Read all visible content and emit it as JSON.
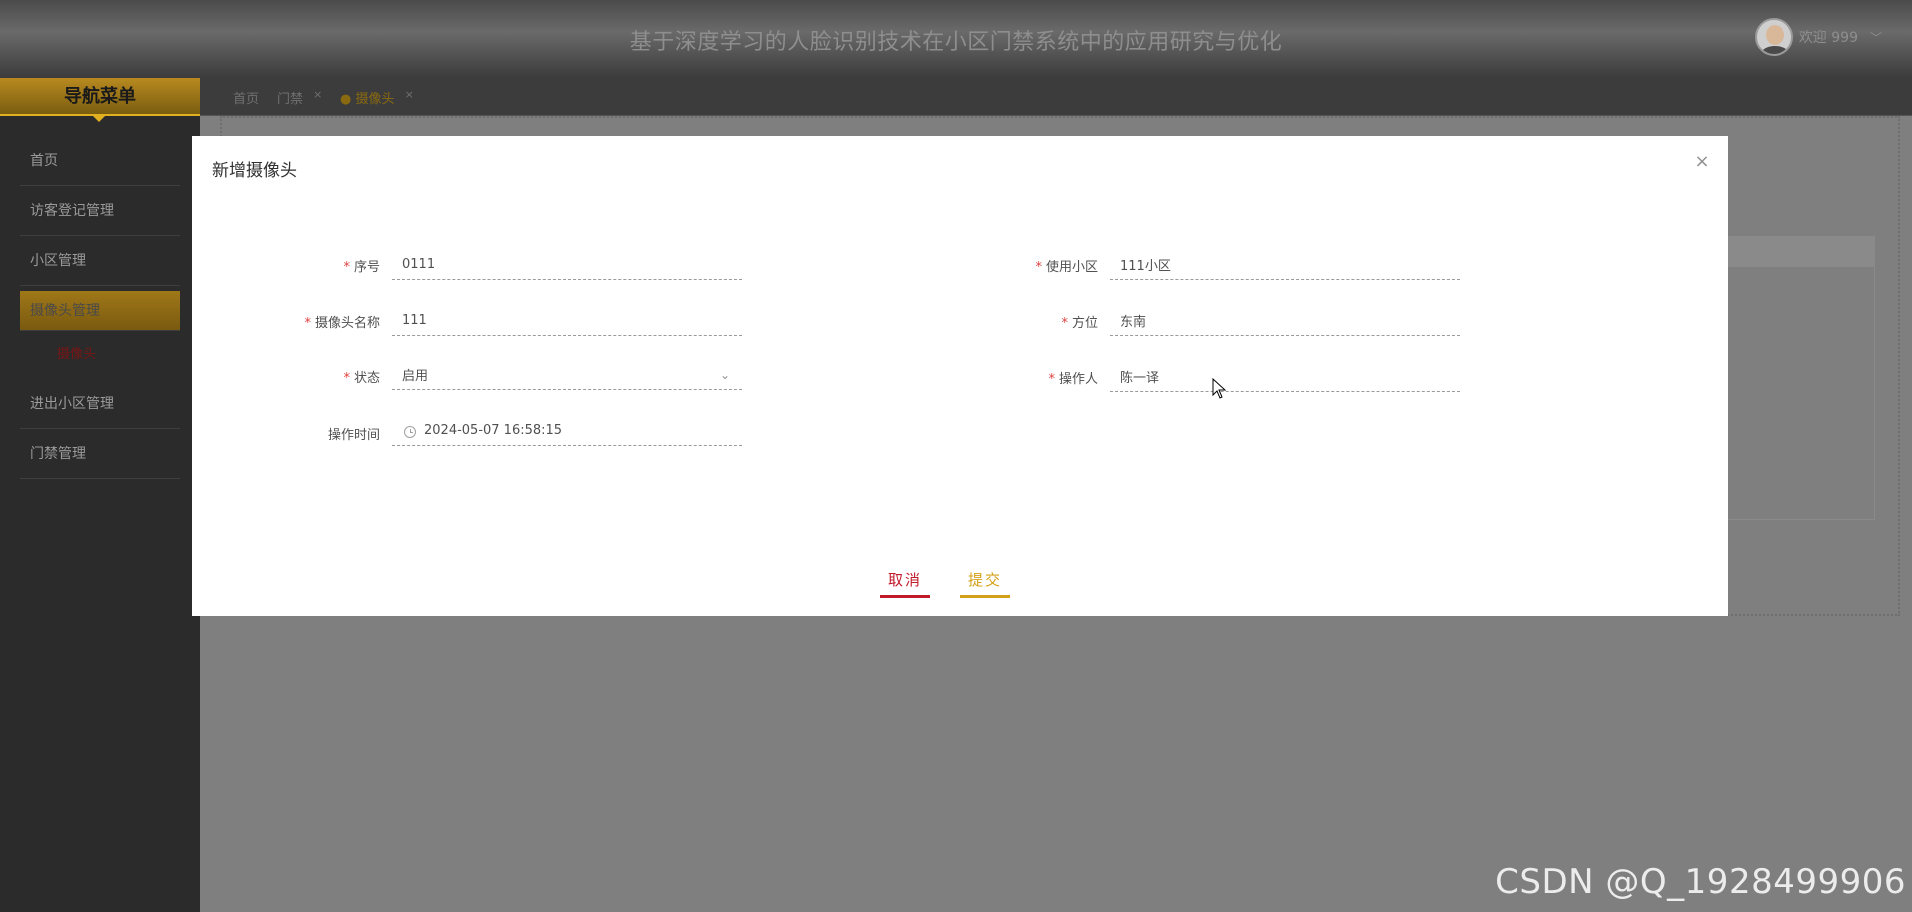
{
  "header": {
    "title": "基于深度学习的人脸识别技术在小区门禁系统中的应用研究与优化",
    "greeting": "欢迎 999",
    "user_chevron": "﹀"
  },
  "sidebar": {
    "title": "导航菜单",
    "items": [
      {
        "label": "首页"
      },
      {
        "label": "访客登记管理"
      },
      {
        "label": "小区管理"
      },
      {
        "label": "摄像头管理"
      },
      {
        "label": "摄像头"
      },
      {
        "label": "进出小区管理"
      },
      {
        "label": "门禁管理"
      }
    ]
  },
  "tabs": [
    {
      "label": "首页"
    },
    {
      "label": "门禁",
      "close": "×"
    },
    {
      "label": "● 摄像头",
      "close": "×"
    }
  ],
  "modal": {
    "title": "新增摄像头",
    "close": "×",
    "fields": {
      "serial": {
        "label": "序号",
        "value": "0111",
        "required": "*"
      },
      "community": {
        "label": "使用小区",
        "value": "111小区",
        "required": "*"
      },
      "camera_name": {
        "label": "摄像头名称",
        "value": "111",
        "required": "*"
      },
      "direction": {
        "label": "方位",
        "value": "东南",
        "required": "*"
      },
      "status": {
        "label": "状态",
        "value": "启用",
        "required": "*"
      },
      "operator": {
        "label": "操作人",
        "value": "陈一译",
        "required": "*"
      },
      "op_time": {
        "label": "操作时间",
        "value": "2024-05-07 16:58:15"
      }
    },
    "cancel_label": "取消",
    "submit_label": "提交"
  },
  "watermark": "CSDN @Q_1928499906"
}
